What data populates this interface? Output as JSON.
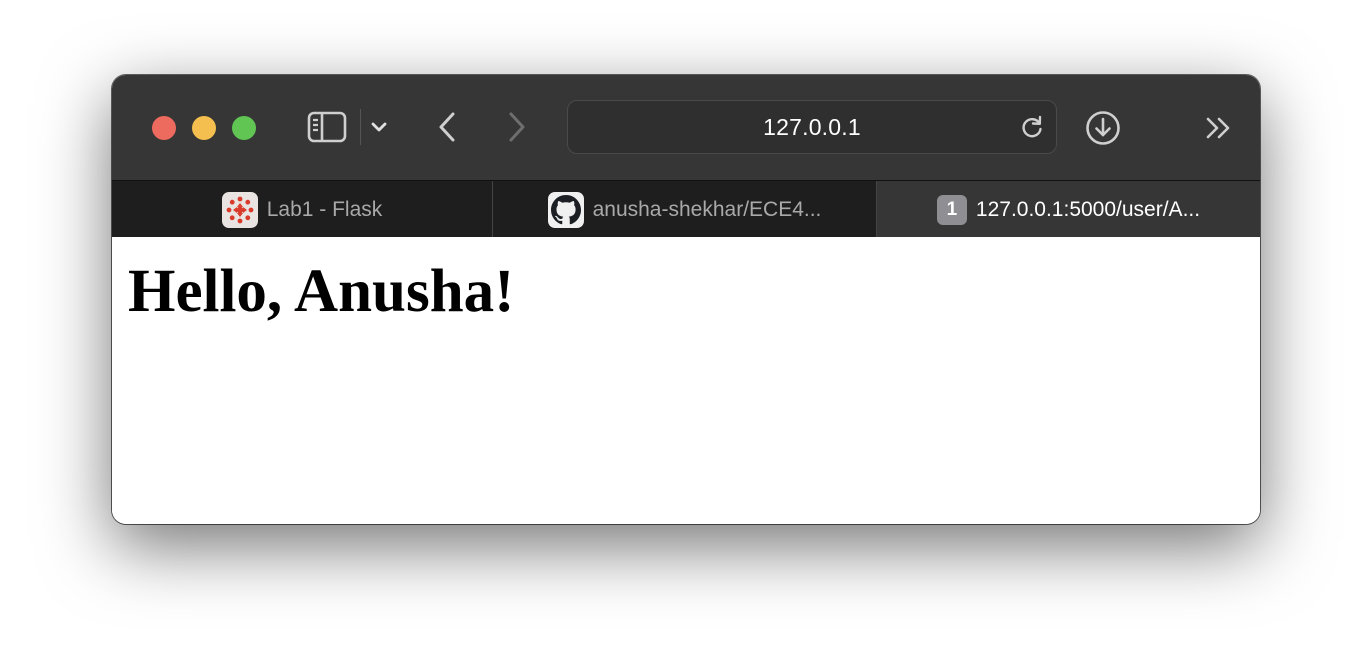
{
  "toolbar": {
    "address": "127.0.0.1"
  },
  "tabs": [
    {
      "label": "Lab1 - Flask",
      "icon": "canvas-logo-icon",
      "active": false
    },
    {
      "label": "anusha-shekhar/ECE4...",
      "icon": "github-icon",
      "active": false
    },
    {
      "label": "127.0.0.1:5000/user/A...",
      "icon": "number-badge-icon",
      "badge": "1",
      "active": true
    }
  ],
  "page": {
    "heading": "Hello, Anusha!"
  },
  "colors": {
    "toolbar_bg": "#363636",
    "tabbar_bg": "#1e1e1e",
    "close": "#ed6a5e",
    "minimize": "#f5bf4f",
    "zoom": "#61c554"
  }
}
